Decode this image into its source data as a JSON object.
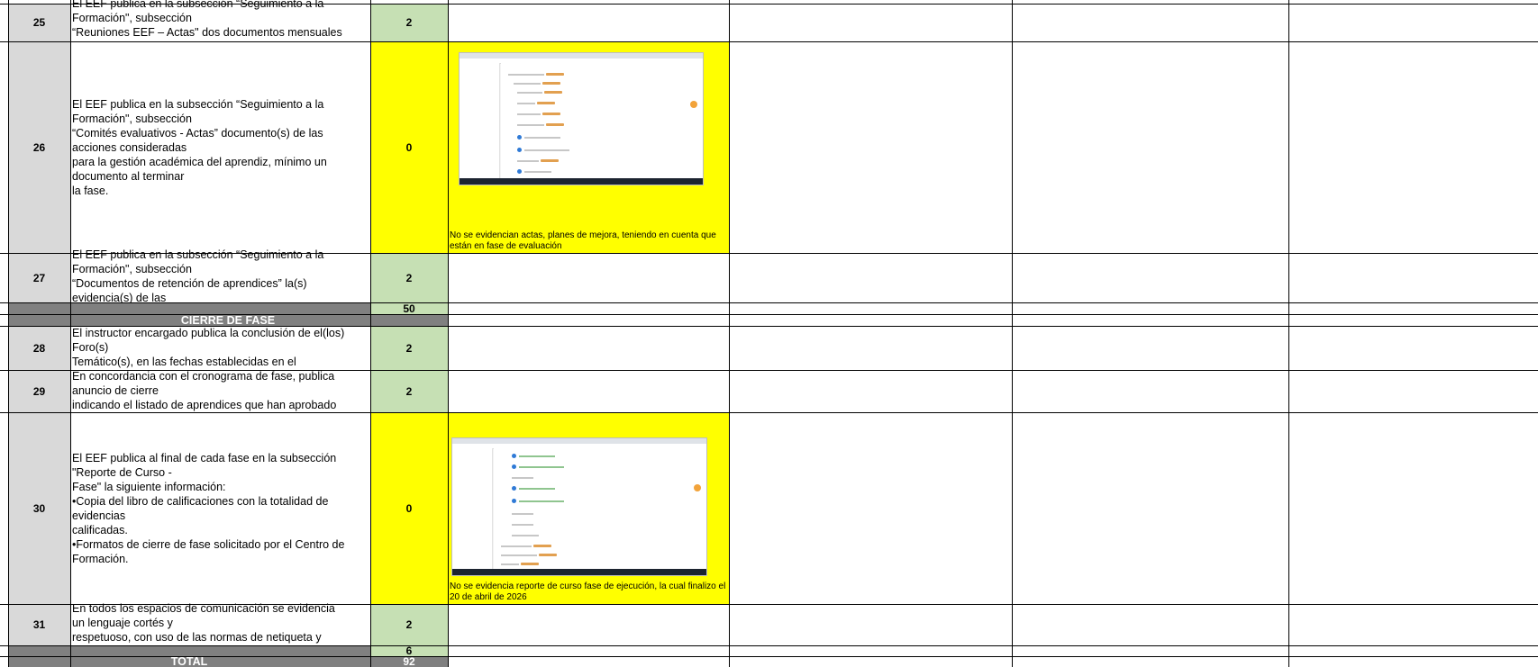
{
  "rows": [
    {
      "num": "25",
      "text": "El EEF publica en la subsección “Seguimiento a la\nFormación\", subsección\n“Reuniones EEF – Actas\" dos documentos mensuales",
      "score": "2"
    },
    {
      "num": "26",
      "text": "El EEF publica en la subsección “Seguimiento a la\nFormación\", subsección\n“Comités evaluativos - Actas” documento(s) de las\nacciones consideradas\npara la gestión académica del aprendiz, mínimo un\ndocumento al terminar\nla fase.",
      "score": "0",
      "observation": "No se evidencian actas, planes de mejora, teniendo en cuenta que están en fase de evaluación"
    },
    {
      "num": "27",
      "text": "El EEF publica en la subsección “Seguimiento a la\nFormación\", subsección\n“Documentos de retención de aprendices” la(s)\nevidencia(s) de las",
      "score": "2"
    },
    {
      "num": "28",
      "text": "El instructor encargado publica la conclusión de el(los)\nForo(s)\nTemático(s), en las fechas establecidas en el",
      "score": "2"
    },
    {
      "num": "29",
      "text": "En concordancia con el cronograma de fase, publica\nanuncio de cierre\nindicando el listado de aprendices que han aprobado",
      "score": "2"
    },
    {
      "num": "30",
      "text": "El EEF publica al final de cada fase en la subsección\n\"Reporte de Curso -\nFase\" la siguiente información:\n•Copia del libro de calificaciones con la totalidad de\nevidencias\ncalificadas.\n•Formatos de cierre de fase solicitado por el Centro de\nFormación.",
      "score": "0",
      "observation": "No se evidencia reporte de curso fase de ejecución, la cual finalizo el 20 de abril de 2026"
    },
    {
      "num": "31",
      "text": "En todos los espacios de comunicación se evidencia\nun lenguaje cortés y\nrespetuoso, con uso de las normas de netiqueta y",
      "score": "2"
    }
  ],
  "subtotal_1": "50",
  "section_title": "CIERRE DE FASE",
  "subtotal_2": "6",
  "total_label": "TOTAL",
  "total_value": "92",
  "colors": {
    "green": "#c6e0b4",
    "yellow": "#ffff00",
    "label_grey": "#d9d9d9",
    "header_grey": "#808080"
  },
  "screenshots": [
    {
      "for_row": "26",
      "icon": "browser-screenshot-icon"
    },
    {
      "for_row": "30",
      "icon": "browser-screenshot-icon"
    }
  ]
}
